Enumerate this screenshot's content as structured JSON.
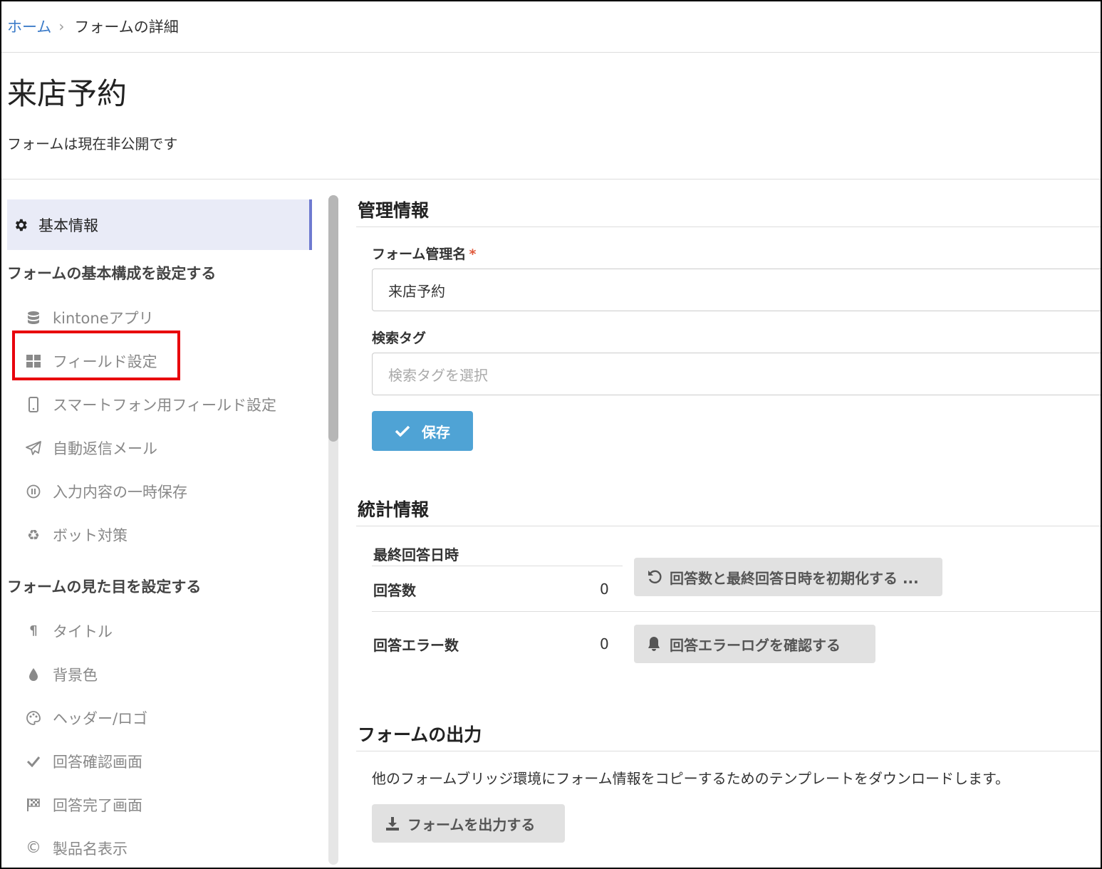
{
  "breadcrumb": {
    "home": "ホーム",
    "current": "フォームの詳細"
  },
  "page": {
    "title": "来店予約",
    "status": "フォームは現在非公開です"
  },
  "sidebar": {
    "active": {
      "icon": "gear-icon",
      "label": "基本情報"
    },
    "group1": {
      "heading": "フォームの基本構成を設定する",
      "items": [
        {
          "icon": "database-icon",
          "label": "kintoneアプリ"
        },
        {
          "icon": "grid-icon",
          "label": "フィールド設定"
        },
        {
          "icon": "mobile-icon",
          "label": "スマートフォン用フィールド設定"
        },
        {
          "icon": "paper-plane-icon",
          "label": "自動返信メール"
        },
        {
          "icon": "pause-circle-icon",
          "label": "入力内容の一時保存"
        },
        {
          "icon": "recycle-icon",
          "label": "ボット対策"
        }
      ]
    },
    "group2": {
      "heading": "フォームの見た目を設定する",
      "items": [
        {
          "icon": "paragraph-icon",
          "label": "タイトル"
        },
        {
          "icon": "tint-icon",
          "label": "背景色"
        },
        {
          "icon": "palette-icon",
          "label": "ヘッダー/ロゴ"
        },
        {
          "icon": "check-icon",
          "label": "回答確認画面"
        },
        {
          "icon": "flag-icon",
          "label": "回答完了画面"
        },
        {
          "icon": "copyright-icon",
          "label": "製品名表示"
        }
      ]
    }
  },
  "management": {
    "title": "管理情報",
    "form_name_label": "フォーム管理名",
    "required_mark": "*",
    "form_name_value": "来店予約",
    "tag_label": "検索タグ",
    "tag_placeholder": "検索タグを選択",
    "save_label": "保存"
  },
  "stats": {
    "title": "統計情報",
    "last_answer_label": "最終回答日時",
    "answer_count_label": "回答数",
    "answer_count_value": "0",
    "reset_button": "回答数と最終回答日時を初期化する ...",
    "error_count_label": "回答エラー数",
    "error_count_value": "0",
    "error_log_button": "回答エラーログを確認する"
  },
  "export": {
    "title": "フォームの出力",
    "description": "他のフォームブリッジ環境にフォーム情報をコピーするためのテンプレートをダウンロードします。",
    "button": "フォームを出力する"
  },
  "colors": {
    "accent": "#4fa3d5",
    "link": "#3d7cc9",
    "highlight": "#e8000c",
    "active_bg": "#e9ebf7",
    "active_border": "#6f7ad0"
  }
}
